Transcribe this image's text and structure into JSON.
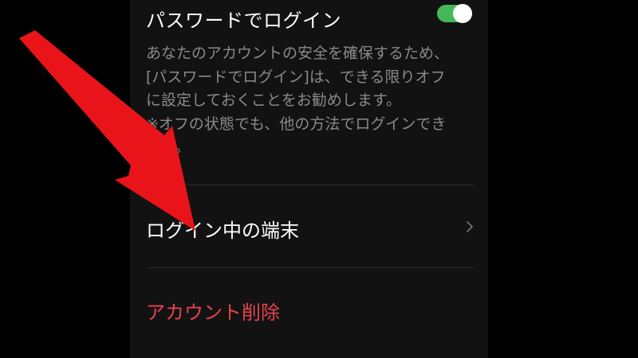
{
  "settings": {
    "password_login": {
      "title": "パスワードでログイン",
      "enabled": true,
      "description_lines": [
        "あなたのアカウントの安全を確保するため、",
        "[パスワードでログイン]は、できる限りオフ",
        "に設定しておくことをお勧めします。",
        "※オフの状態でも、他の方法でログインでき",
        "ます。"
      ]
    },
    "logged_in_devices": {
      "label": "ログイン中の端末"
    },
    "delete_account": {
      "label": "アカウント削除"
    }
  },
  "icons": {
    "row_chevron": "chevron-right-icon",
    "annotation": "red-arrow-icon"
  },
  "colors": {
    "background": "#000000",
    "panel": "#121212",
    "toggle_on": "#45b95a",
    "primary_text": "#ffffff",
    "secondary_text": "#8a8a8a",
    "danger_text": "#e8424f",
    "annotation_arrow": "#e8141a"
  }
}
